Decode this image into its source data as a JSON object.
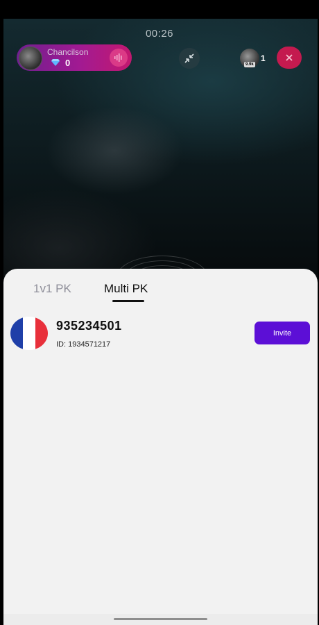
{
  "live": {
    "timer": "00:26",
    "host": {
      "name": "Chancilson",
      "gem_icon": "diamond-icon",
      "gem_count": "0"
    },
    "viewers": {
      "tag": "9.9k",
      "count": "1"
    },
    "icons": {
      "voice": "sound-wave-icon",
      "minimize": "minimize-arrows-icon",
      "close": "close-icon"
    },
    "colors": {
      "host_pill_start": "#6f1f8f",
      "host_pill_end": "#c3186f",
      "close_button": "#c41a4f"
    }
  },
  "sheet": {
    "tabs": [
      {
        "label": "1v1 PK",
        "active": false
      },
      {
        "label": "Multi PK",
        "active": true
      }
    ],
    "users": [
      {
        "name": "935234501",
        "id_text": "ID: 1934571217",
        "flag_icon": "france-flag-icon",
        "action_label": "Invite"
      }
    ],
    "colors": {
      "invite_button": "#5c0fd6",
      "background": "#f2f2f2",
      "flag_blue": "#1f3fa8",
      "flag_white": "#ffffff",
      "flag_red": "#e8303b"
    }
  }
}
